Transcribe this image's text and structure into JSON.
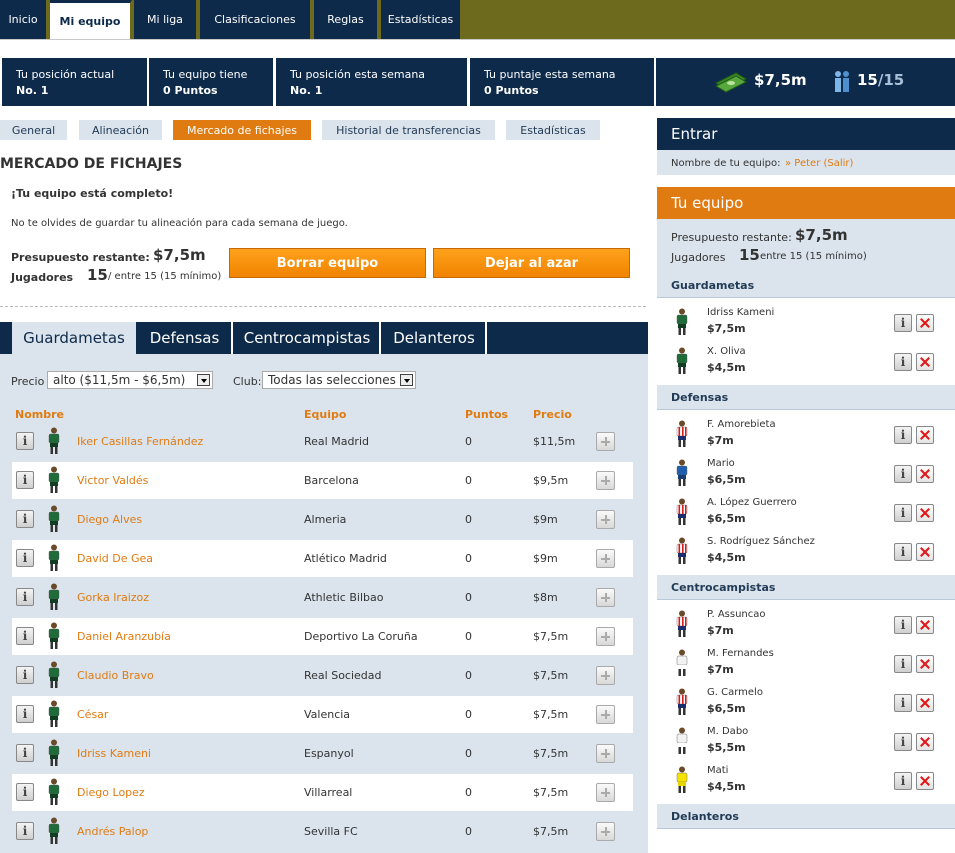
{
  "topnav": [
    "Inicio",
    "Mi equipo",
    "Mi liga",
    "Clasificaciones",
    "Reglas",
    "Estadísticas"
  ],
  "stats": [
    {
      "label": "Tu posición actual",
      "value": "No. 1"
    },
    {
      "label": "Tu equipo tiene",
      "value": "0 Puntos"
    },
    {
      "label": "Tu posición esta semana",
      "value": "No. 1"
    },
    {
      "label": "Tu puntaje esta semana",
      "value": "0 Puntos"
    }
  ],
  "money": "$7,5m",
  "players_count": "15",
  "players_total": "/15",
  "subtabs": [
    "General",
    "Alineación",
    "Mercado de fichajes",
    "Historial de transferencias",
    "Estadísticas"
  ],
  "heading": "MERCADO DE FICHAJES",
  "complete_msg": "¡Tu equipo está completo!",
  "reminder": "No te olvides de guardar tu alineación para cada semana de juego.",
  "budget_label": "Presupuesto restante:",
  "budget_value": "$7,5m",
  "players_label": "Jugadores",
  "players_value": "15",
  "players_suffix": "/ entre 15 (15 mínimo)",
  "buttons": {
    "clear": "Borrar equipo",
    "random": "Dejar al azar"
  },
  "pos_tabs": [
    "Guardametas",
    "Defensas",
    "Centrocampistas",
    "Delanteros"
  ],
  "filters": {
    "price_label": "Precio",
    "price_value": "alto ($11,5m - $6,5m)",
    "club_label": "Club:",
    "club_value": "Todas las selecciones"
  },
  "columns": {
    "name": "Nombre",
    "team": "Equipo",
    "points": "Puntos",
    "price": "Precio"
  },
  "market": [
    {
      "name": "Iker Casillas Fernández",
      "team": "Real Madrid",
      "points": "0",
      "price": "$11,5m"
    },
    {
      "name": "Victor Valdés",
      "team": "Barcelona",
      "points": "0",
      "price": "$9,5m"
    },
    {
      "name": "Diego Alves",
      "team": "Almeria",
      "points": "0",
      "price": "$9m"
    },
    {
      "name": "David De Gea",
      "team": "Atlético Madrid",
      "points": "0",
      "price": "$9m"
    },
    {
      "name": "Gorka Iraizoz",
      "team": "Athletic Bilbao",
      "points": "0",
      "price": "$8m"
    },
    {
      "name": "Daniel Aranzubía",
      "team": "Deportivo La Coruña",
      "points": "0",
      "price": "$7,5m"
    },
    {
      "name": "Claudio Bravo",
      "team": "Real Sociedad",
      "points": "0",
      "price": "$7,5m"
    },
    {
      "name": "César",
      "team": "Valencia",
      "points": "0",
      "price": "$7,5m"
    },
    {
      "name": "Idriss Kameni",
      "team": "Espanyol",
      "points": "0",
      "price": "$7,5m"
    },
    {
      "name": "Diego Lopez",
      "team": "Villarreal",
      "points": "0",
      "price": "$7,5m"
    },
    {
      "name": "Andrés Palop",
      "team": "Sevilla FC",
      "points": "0",
      "price": "$7,5m"
    }
  ],
  "sidebar": {
    "login_title": "Entrar",
    "team_name_label": "Nombre de tu equipo:",
    "team_name_value": "» Peter (Salir)",
    "team_title": "Tu equipo",
    "budget_label": "Presupuesto restante:",
    "budget_value": "$7,5m",
    "players_label": "Jugadores",
    "players_value": "15",
    "players_suffix": "entre 15 (15 mínimo)",
    "sections": [
      {
        "title": "Guardametas",
        "players": [
          {
            "name": "Idriss Kameni",
            "price": "$7,5m",
            "kit": "gk"
          },
          {
            "name": "X. Oliva",
            "price": "$4,5m",
            "kit": "gk"
          }
        ]
      },
      {
        "title": "Defensas",
        "players": [
          {
            "name": "F. Amorebieta",
            "price": "$7m",
            "kit": "stripe"
          },
          {
            "name": "Mario",
            "price": "$6,5m",
            "kit": "blue"
          },
          {
            "name": "A. López Guerrero",
            "price": "$6,5m",
            "kit": "stripe"
          },
          {
            "name": "S. Rodríguez Sánchez",
            "price": "$4,5m",
            "kit": "stripe"
          }
        ]
      },
      {
        "title": "Centrocampistas",
        "players": [
          {
            "name": "P. Assuncao",
            "price": "$7m",
            "kit": "stripe"
          },
          {
            "name": "M. Fernandes",
            "price": "$7m",
            "kit": "white"
          },
          {
            "name": "G. Carmelo",
            "price": "$6,5m",
            "kit": "stripe"
          },
          {
            "name": "M. Dabo",
            "price": "$5,5m",
            "kit": "white"
          },
          {
            "name": "Mati",
            "price": "$4,5m",
            "kit": "yellow"
          }
        ]
      },
      {
        "title": "Delanteros",
        "players": []
      }
    ]
  }
}
